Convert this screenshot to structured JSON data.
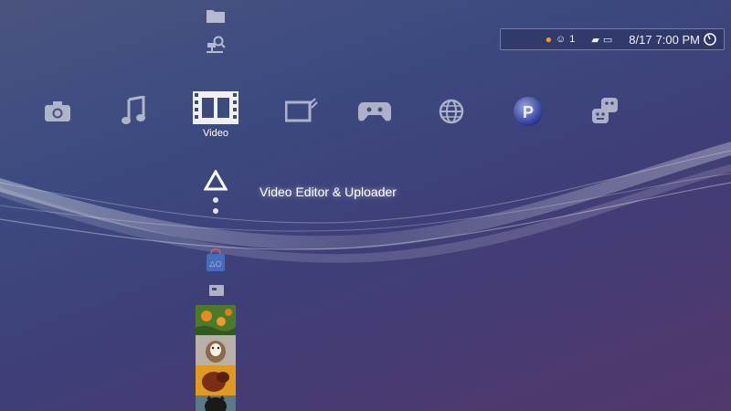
{
  "status_bar": {
    "friend_count": "1",
    "date": "8/17",
    "time": "7:00 PM"
  },
  "categories": [
    {
      "name": "Photo",
      "icon": "camera-icon"
    },
    {
      "name": "Music",
      "icon": "music-note-icon"
    },
    {
      "name": "Video",
      "icon": "film-strip-icon",
      "selected": true
    },
    {
      "name": "TV",
      "icon": "tv-icon"
    },
    {
      "name": "Game",
      "icon": "gamepad-icon"
    },
    {
      "name": "Network",
      "icon": "globe-icon"
    },
    {
      "name": "PlayStation Network",
      "icon": "psn-icon"
    },
    {
      "name": "Friends",
      "icon": "friends-icon"
    }
  ],
  "selected_category_label": "Video",
  "selected_item_label": "Video Editor & Uploader",
  "colors": {
    "background_top": "#4b5480",
    "background_bottom": "#52386c",
    "text": "#ffffff"
  }
}
